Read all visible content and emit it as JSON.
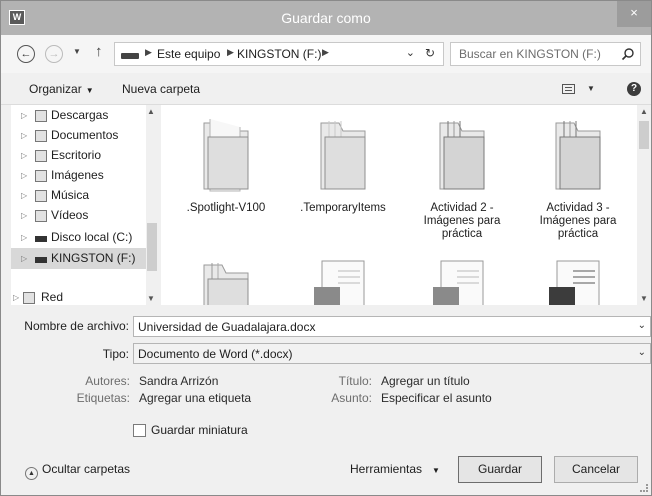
{
  "window": {
    "title": "Guardar como",
    "app_icon": "W",
    "close": "×"
  },
  "address": {
    "crumbs": [
      "Este equipo",
      "KINGSTON (F:)"
    ],
    "search_placeholder": "Buscar en KINGSTON (F:)"
  },
  "toolbar": {
    "organize": "Organizar",
    "new_folder": "Nueva carpeta",
    "help": "?"
  },
  "nav": {
    "items": [
      {
        "label": "Descargas",
        "icon": "downloads-icon"
      },
      {
        "label": "Documentos",
        "icon": "documents-icon"
      },
      {
        "label": "Escritorio",
        "icon": "desktop-icon"
      },
      {
        "label": "Imágenes",
        "icon": "pictures-icon"
      },
      {
        "label": "Música",
        "icon": "music-icon"
      },
      {
        "label": "Vídeos",
        "icon": "videos-icon"
      },
      {
        "label": "Disco local (C:)",
        "icon": "local-disk-icon"
      },
      {
        "label": "KINGSTON (F:)",
        "icon": "usb-drive-icon",
        "selected": true
      },
      {
        "label": "Red",
        "icon": "network-icon"
      }
    ]
  },
  "files": [
    {
      "label": ".Spotlight-V100",
      "type": "folder"
    },
    {
      "label": ".TemporaryItems",
      "type": "folder"
    },
    {
      "label": "Actividad 2 - Imágenes para práctica",
      "type": "folder"
    },
    {
      "label": "Actividad 3 - Imágenes para práctica",
      "type": "folder"
    },
    {
      "label": "",
      "type": "folder"
    },
    {
      "label": "",
      "type": "document"
    },
    {
      "label": "",
      "type": "document"
    },
    {
      "label": "",
      "type": "document"
    }
  ],
  "form": {
    "filename_label": "Nombre de archivo:",
    "filename_value": "Universidad de Guadalajara.docx",
    "type_label": "Tipo:",
    "type_value": "Documento de Word (*.docx)"
  },
  "meta": {
    "authors_label": "Autores:",
    "authors_value": "Sandra Arrizón",
    "tags_label": "Etiquetas:",
    "tags_value": "Agregar una etiqueta",
    "title_label": "Título:",
    "title_value": "Agregar un título",
    "subject_label": "Asunto:",
    "subject_value": "Especificar el asunto"
  },
  "thumbnail_label": "Guardar miniatura",
  "footer": {
    "hide_folders": "Ocultar carpetas",
    "tools": "Herramientas",
    "save": "Guardar",
    "cancel": "Cancelar"
  },
  "colors": {
    "titlebar": "#b3b3b3",
    "selection": "#d8d8d8",
    "window_bg": "#f0f0f0"
  }
}
